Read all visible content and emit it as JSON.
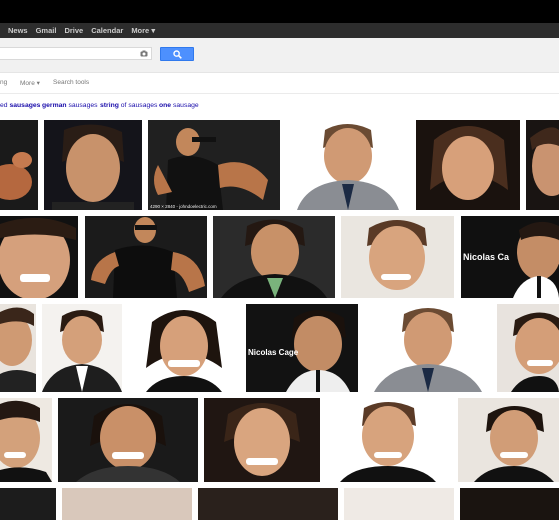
{
  "nav": {
    "items": [
      "News",
      "Gmail",
      "Drive",
      "Calendar",
      "More ▾"
    ]
  },
  "search": {
    "value": "",
    "placeholder": ""
  },
  "tools": {
    "items": [
      "ng",
      "More ▾",
      "Search tools"
    ]
  },
  "related": [
    {
      "prefix": "ed ",
      "bold": "sausages",
      "rest": ""
    },
    {
      "prefix": "",
      "bold": "german",
      "rest": " sausages"
    },
    {
      "prefix": "",
      "bold": "string",
      "rest": " of sausages"
    },
    {
      "prefix": "",
      "bold": "one",
      "rest": " sausage"
    }
  ],
  "captions": {
    "img3": "4290 × 2840 - johndoelectric.com"
  },
  "watermarks": {
    "w1": "Nicolas Ca",
    "w2": "Nicolas Cage"
  },
  "colors": {
    "topbar": "#2d2d2d",
    "header_bg": "#f1f1f1",
    "search_button": "#4d90fe",
    "link": "#1a0dab"
  },
  "icons": {
    "camera": "camera-icon",
    "search": "magnifier-icon"
  }
}
